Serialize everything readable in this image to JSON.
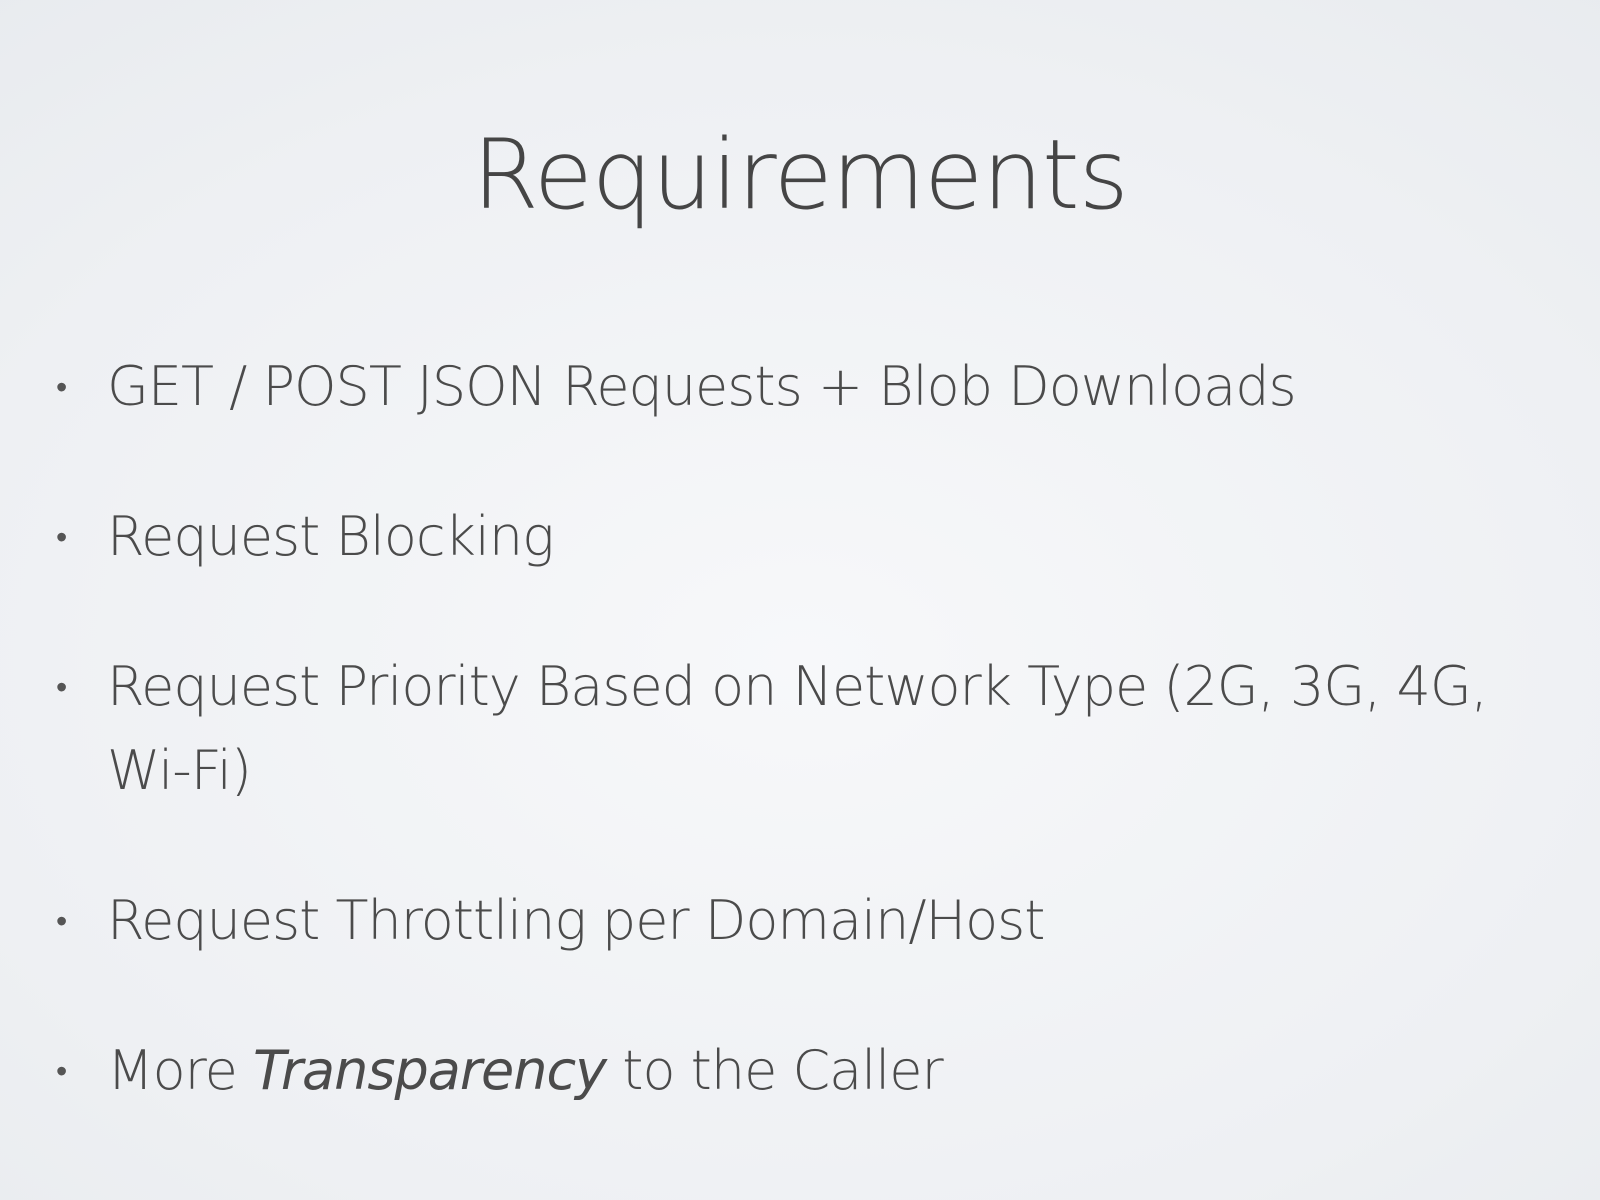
{
  "slide": {
    "title": "Requirements",
    "bullets": [
      {
        "text": "GET / POST JSON Requests + Blob Downloads"
      },
      {
        "text": "Request Blocking"
      },
      {
        "text": "Request Priority Based on Network Type (2G, 3G, 4G, Wi-Fi)"
      },
      {
        "text": "Request Throttling per Domain/Host"
      },
      {
        "before": "More ",
        "emphasis": "Transparency",
        "after": " to the Caller"
      }
    ],
    "bullet_glyph": "•"
  }
}
